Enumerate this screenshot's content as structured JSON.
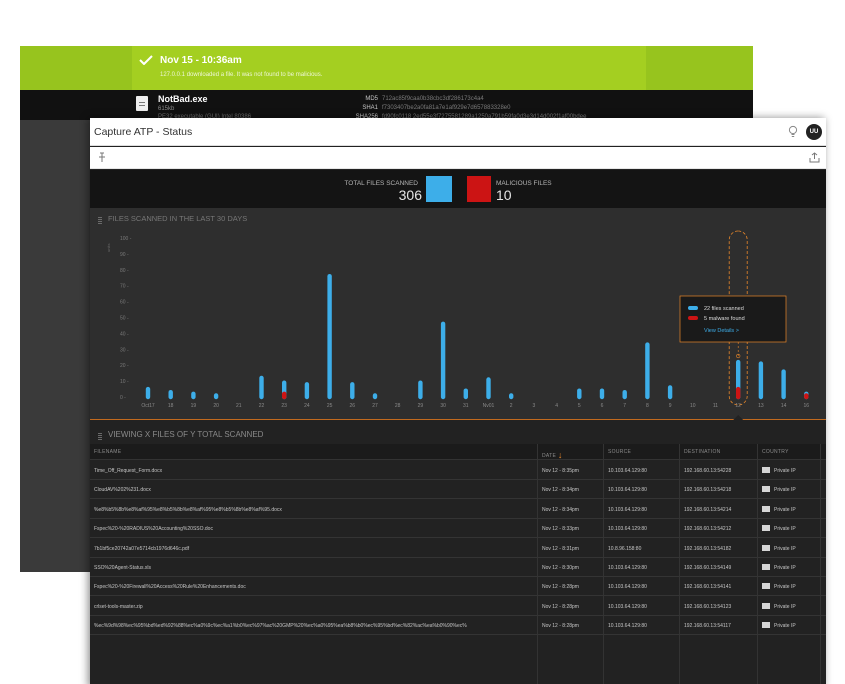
{
  "background_window": {
    "notification": {
      "title": "Nov 15 - 10:36am",
      "message": "127.0.0.1 downloaded a file. It was not found to be malicious."
    },
    "file": {
      "name": "NotBad.exe",
      "size": "615kb",
      "type": "PE32 executable (GUI) Intel 80386",
      "hashes": [
        {
          "key": "MD5",
          "value": "712ac85f9caa0b38cbc3df286173c4a4"
        },
        {
          "key": "SHA1",
          "value": "f7303407be2a0fa81a7e1af929e7d657883328e0"
        },
        {
          "key": "SHA256",
          "value": "fd90fc0118 2ed55e3f7275581289a1250a791b59fa0d3e3d14d002f1af00bdee"
        }
      ]
    }
  },
  "app": {
    "title": "Capture ATP - Status",
    "user_initials": "UU"
  },
  "summary": {
    "total_label": "TOTAL FILES SCANNED",
    "total_value": "306",
    "malicious_label": "MALICIOUS FILES",
    "malicious_value": "10",
    "total_color": "#3daee9",
    "malicious_color": "#cc1414"
  },
  "chart_data": {
    "type": "bar",
    "title": "FILES SCANNED IN THE LAST 30 DAYS",
    "ylabel": "units",
    "ylim": [
      0,
      100
    ],
    "yticks": [
      0,
      10,
      20,
      30,
      40,
      50,
      60,
      70,
      80,
      90,
      100
    ],
    "categories": [
      "Oct17",
      "18",
      "19",
      "20",
      "21",
      "22",
      "23",
      "24",
      "25",
      "26",
      "27",
      "28",
      "29",
      "30",
      "31",
      "Nv01",
      "2",
      "3",
      "4",
      "5",
      "6",
      "7",
      "8",
      "9",
      "10",
      "11",
      "12",
      "13",
      "14",
      "16"
    ],
    "series": [
      {
        "name": "files scanned",
        "color": "#3daee9",
        "values": [
          5,
          3,
          2,
          1,
          0,
          12,
          9,
          8,
          76,
          8,
          1,
          0,
          9,
          46,
          4,
          11,
          1,
          0,
          0,
          4,
          4,
          3,
          33,
          6,
          0,
          0,
          22,
          21,
          16,
          2
        ]
      },
      {
        "name": "malware found",
        "color": "#cc1414",
        "values": [
          0,
          0,
          0,
          0,
          0,
          0,
          2,
          0,
          0,
          0,
          0,
          0,
          0,
          0,
          0,
          0,
          0,
          0,
          0,
          0,
          0,
          0,
          0,
          0,
          0,
          0,
          5,
          0,
          0,
          1
        ]
      }
    ],
    "tooltip": {
      "category": "12",
      "scanned_text": "22 files scanned",
      "malware_text": "5 malware found",
      "link_text": "View Details >"
    }
  },
  "table": {
    "title": "VIEWING X FILES OF Y TOTAL SCANNED",
    "columns": [
      "FILENAME",
      "DATE",
      "SOURCE",
      "DESTINATION",
      "COUNTRY"
    ],
    "sort_indicator": "↓",
    "rows": [
      {
        "filename": "Time_Off_Request_Form.docx",
        "date": "Nov 12 - 8:35pm",
        "source": "10.103.64.129:80",
        "destination": "192.168.60.13:54228",
        "country": "Private IP"
      },
      {
        "filename": "CloudAV%202%231.docx",
        "date": "Nov 12 - 8:34pm",
        "source": "10.103.64.129:80",
        "destination": "192.168.60.13:54218",
        "country": "Private IP"
      },
      {
        "filename": "%e8%b5%8b%e8%af%95%e8%b5%8b%e8%af%95%e8%b5%8b%e8%af%95.docx",
        "date": "Nov 12 - 8:34pm",
        "source": "10.103.64.129:80",
        "destination": "192.168.60.13:54214",
        "country": "Private IP"
      },
      {
        "filename": "Fspec%20-%20RADIUS%20Accounting%20SSO.doc",
        "date": "Nov 12 - 8:33pm",
        "source": "10.103.64.129:80",
        "destination": "192.168.60.13:54212",
        "country": "Private IP"
      },
      {
        "filename": "7b1bf5ce20742a07e5714cb1976d646c.pdf",
        "date": "Nov 12 - 8:31pm",
        "source": "10.8.96.158:80",
        "destination": "192.168.60.13:54182",
        "country": "Private IP"
      },
      {
        "filename": "SSO%20Agent-Status.xls",
        "date": "Nov 12 - 8:30pm",
        "source": "10.103.64.129:80",
        "destination": "192.168.60.13:54149",
        "country": "Private IP"
      },
      {
        "filename": "Fspec%20-%20Firewall%20Access%20Rule%20Enhancements.doc",
        "date": "Nov 12 - 8:28pm",
        "source": "10.103.64.129:80",
        "destination": "192.168.60.13:54141",
        "country": "Private IP"
      },
      {
        "filename": "crlset-tools-master.zip",
        "date": "Nov 12 - 8:28pm",
        "source": "10.103.64.129:80",
        "destination": "192.168.60.13:54123",
        "country": "Private IP"
      },
      {
        "filename": "%ec%9d%98%ec%95%bd%ed%92%88%ec%a0%9c%ec%a1%b0%ec%97%ac%20GMP%20%ec%a0%95%ea%b8%b0%ec%95%bd%ec%82%ac%ea%b0%90%ec%",
        "date": "Nov 12 - 8:28pm",
        "source": "10.103.64.129:80",
        "destination": "192.168.60.13:54117",
        "country": "Private IP"
      }
    ]
  }
}
